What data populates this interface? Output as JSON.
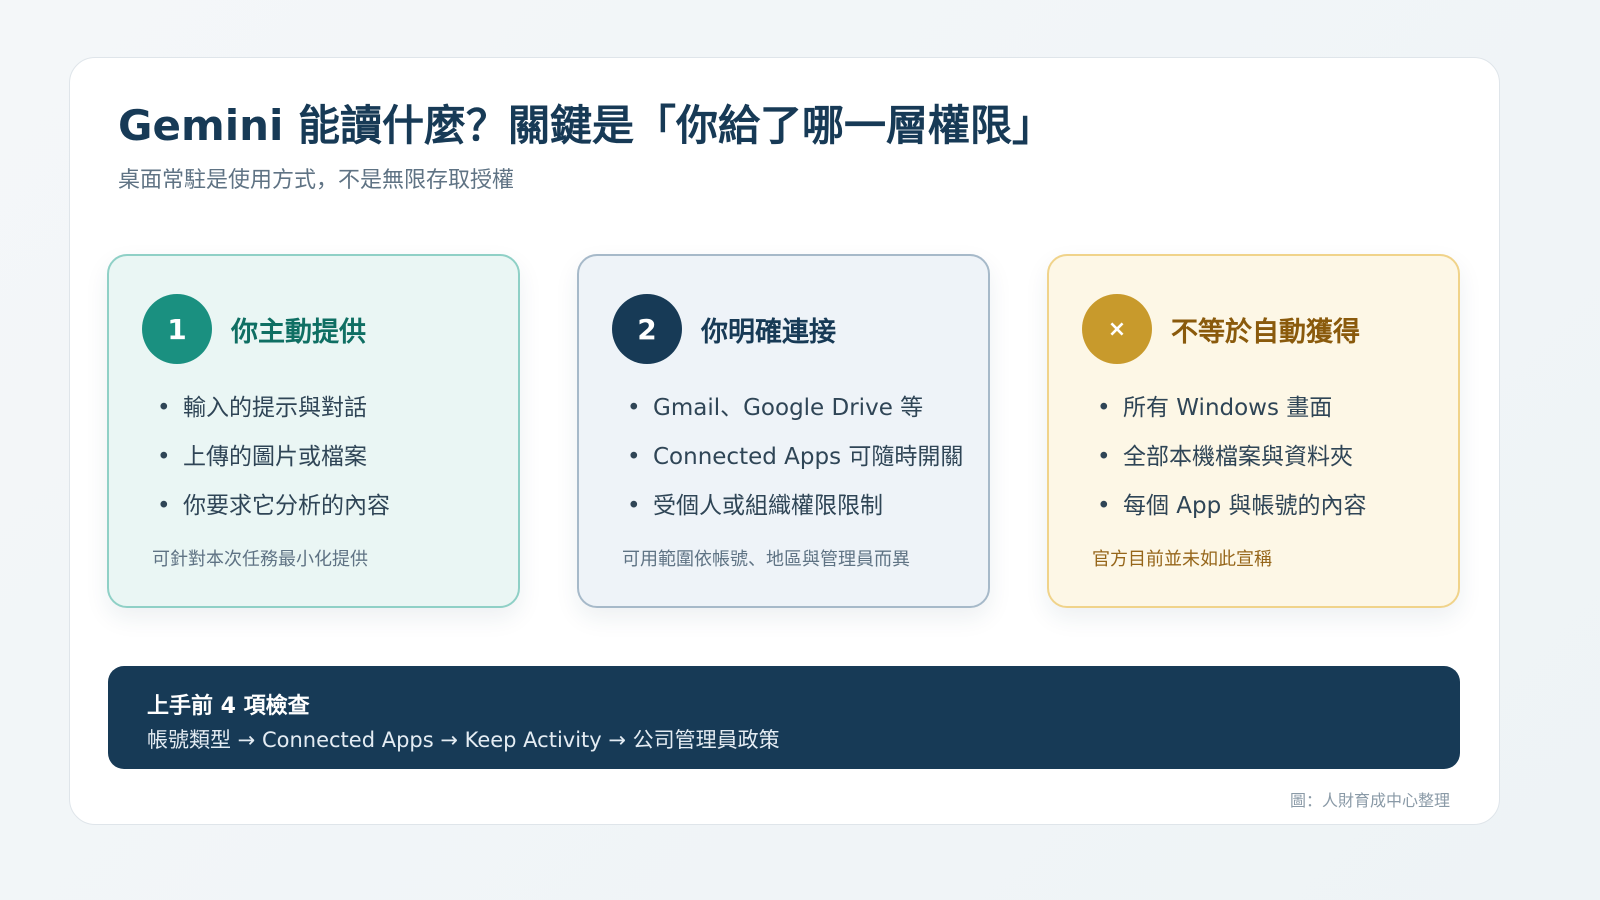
{
  "header": {
    "title": "Gemini 能讀什麼？關鍵是「你給了哪一層權限」",
    "subtitle": "桌面常駐是使用方式，不是無限存取授權"
  },
  "panels": [
    {
      "badge": "1",
      "title": "你主動提供",
      "bullets": [
        "輸入的提示與對話",
        "上傳的圖片或檔案",
        "你要求它分析的內容"
      ],
      "note": "可針對本次任務最小化提供",
      "accent": "#1a9080"
    },
    {
      "badge": "2",
      "title": "你明確連接",
      "bullets": [
        "Gmail、Google Drive 等",
        "Connected Apps 可隨時開關",
        "受個人或組織權限限制"
      ],
      "note": "可用範圍依帳號、地區與管理員而異",
      "accent": "#173a56"
    },
    {
      "badge": "×",
      "title": "不等於自動獲得",
      "bullets": [
        "所有 Windows 畫面",
        "全部本機檔案與資料夾",
        "每個 App 與帳號的內容"
      ],
      "note": "官方目前並未如此宣稱",
      "accent": "#c89a2c"
    }
  ],
  "checklist": {
    "title": "上手前 4 項檢查",
    "text": "帳號類型 → Connected Apps → Keep Activity → 公司管理員政策"
  },
  "source": "圖：人財育成中心整理",
  "bullet_symbol": "•"
}
